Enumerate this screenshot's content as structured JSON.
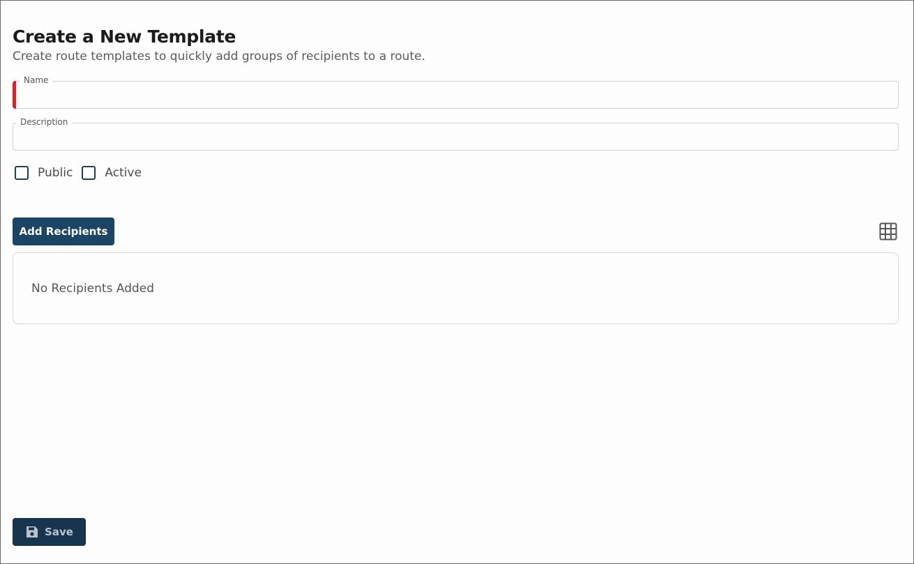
{
  "header": {
    "title": "Create a New Template",
    "subtitle": "Create route templates to quickly add groups of recipients to a route."
  },
  "form": {
    "name": {
      "label": "Name",
      "value": "",
      "required": true
    },
    "description": {
      "label": "Description",
      "value": ""
    },
    "checkboxes": [
      {
        "label": "Public",
        "checked": false
      },
      {
        "label": "Active",
        "checked": false
      }
    ]
  },
  "recipients": {
    "add_button_label": "Add Recipients",
    "empty_text": "No Recipients Added"
  },
  "footer": {
    "save_label": "Save"
  },
  "colors": {
    "primary": "#1b4565",
    "save_button": "#17354f",
    "required_marker": "#e02020"
  },
  "icons": {
    "grid": "grid-icon",
    "save": "floppy-disk-icon"
  }
}
